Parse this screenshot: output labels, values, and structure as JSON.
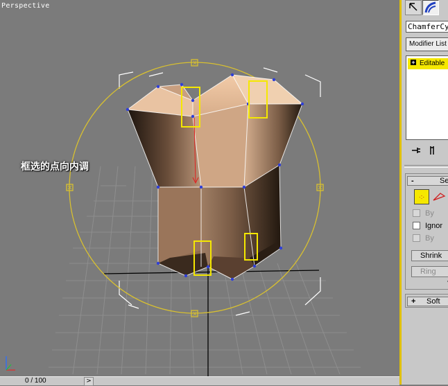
{
  "viewport": {
    "label": "Perspective",
    "annotation": "框选的点向内调"
  },
  "statusbar": {
    "frame_counter": "0 / 100",
    "next_frame_symbol": ">"
  },
  "panel": {
    "tabs": [
      "create-tab",
      "modify-tab"
    ],
    "object_name": "ChamferCyl",
    "modifier_list_label": "Modifier List",
    "stack": [
      {
        "expander": "+",
        "label": "Editable"
      }
    ],
    "selection_rollout": {
      "toggle": "-",
      "title": "Se",
      "vertex_button_label": "·:·",
      "options": [
        {
          "label": "By",
          "checked": false,
          "enabled": false
        },
        {
          "label": "Ignor",
          "checked": false,
          "enabled": true
        },
        {
          "label": "By",
          "checked": false,
          "enabled": false
        }
      ],
      "shrink_label": "Shrink",
      "ring_label": "Ring",
      "arrow_glyph": "▾"
    },
    "soft_rollout": {
      "toggle": "+",
      "title": "Soft"
    }
  },
  "colors": {
    "viewport_bg": "#7b7b7b",
    "active_border": "#e0c000",
    "gizmo": "#d8c030",
    "vertex": "#2f3fd8",
    "highlight": "#f5e800"
  }
}
